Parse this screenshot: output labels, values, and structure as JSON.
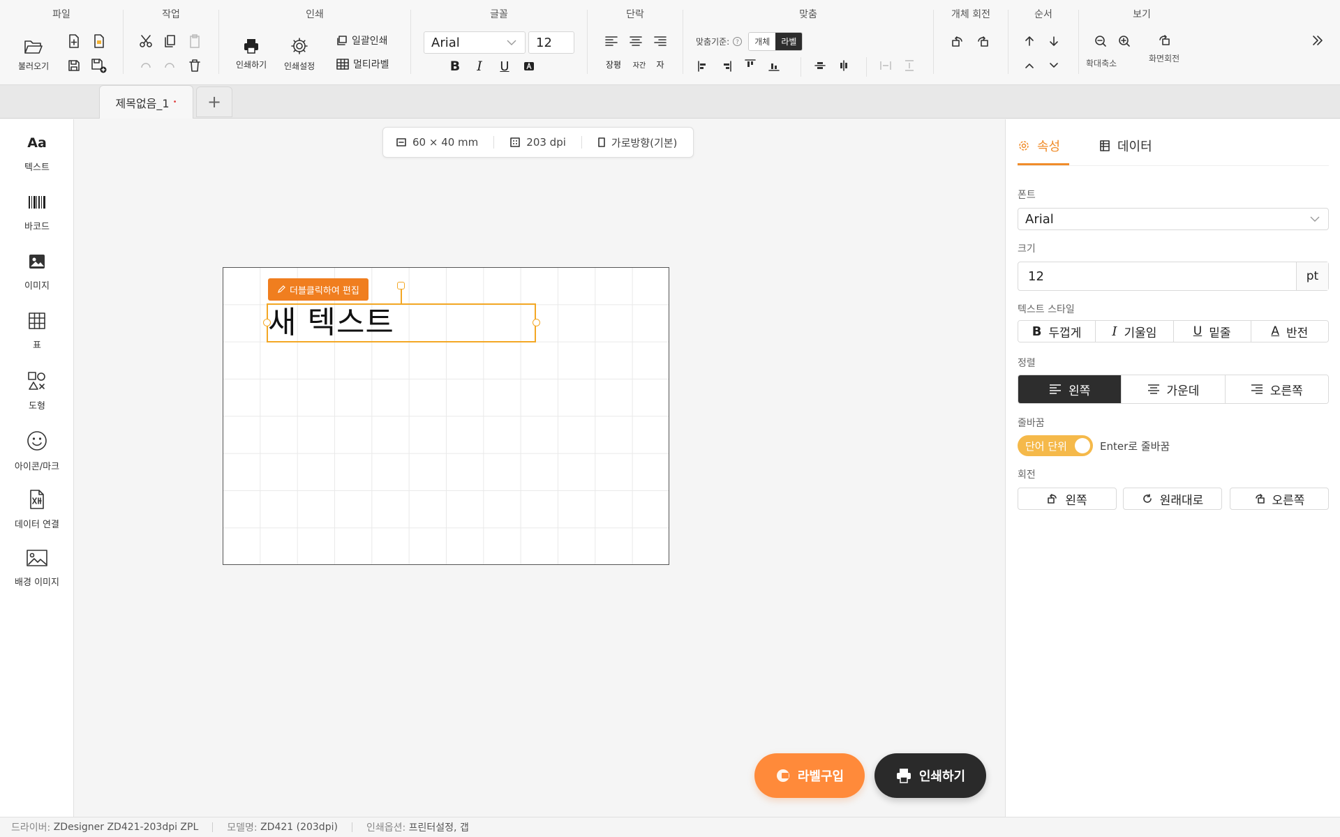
{
  "ribbon": {
    "file": {
      "title": "파일",
      "open_label": "불러오기"
    },
    "edit": {
      "title": "작업"
    },
    "print": {
      "title": "인쇄",
      "print_label": "인쇄하기",
      "settings_label": "인쇄설정",
      "batch_label": "일괄인쇄",
      "multi_label": "멀티라벨"
    },
    "font": {
      "title": "글꼴",
      "family": "Arial",
      "size": "12",
      "bold": "B",
      "italic": "I",
      "underline": "U"
    },
    "paragraph": {
      "title": "단락",
      "jangpyeong": "장평",
      "jagan": "자간",
      "ja": "자"
    },
    "align": {
      "title": "맞춤",
      "basis_label": "맞춤기준:",
      "basis_object": "개체",
      "basis_label_opt": "라벨"
    },
    "rotate": {
      "title": "개체 회전"
    },
    "order": {
      "title": "순서"
    },
    "view": {
      "title": "보기",
      "zoom_label": "확대축소",
      "screen_rotate_label": "화면회전"
    }
  },
  "tabs": {
    "doc_name": "제목없음_1",
    "dirty_mark": "•",
    "add": "+"
  },
  "tools": [
    {
      "icon": "text-icon",
      "label": "텍스트",
      "glyph": "Aa"
    },
    {
      "icon": "barcode-icon",
      "label": "바코드"
    },
    {
      "icon": "image-icon",
      "label": "이미지"
    },
    {
      "icon": "table-icon",
      "label": "표"
    },
    {
      "icon": "shape-icon",
      "label": "도형"
    },
    {
      "icon": "emoji-icon",
      "label": "아이콘/마크"
    },
    {
      "icon": "data-link-icon",
      "label": "데이터 연결"
    },
    {
      "icon": "background-image-icon",
      "label": "배경 이미지"
    }
  ],
  "canvas": {
    "info": {
      "size": "60 × 40 mm",
      "dpi": "203 dpi",
      "orientation": "가로방향(기본)"
    },
    "edit_hint": "더블클릭하여 편집",
    "text_content": "새 텍스트",
    "buy_button": "라벨구입",
    "print_button": "인쇄하기"
  },
  "panel": {
    "tab_props": "속성",
    "tab_data": "데이터",
    "font_label": "폰트",
    "font_value": "Arial",
    "size_label": "크기",
    "size_value": "12",
    "size_unit": "pt",
    "style_label": "텍스트 스타일",
    "style_bold": "두껍게",
    "style_italic": "기울임",
    "style_underline": "밑줄",
    "style_invert": "반전",
    "style_bold_glyph": "B",
    "style_italic_glyph": "I",
    "style_underline_glyph": "U",
    "style_invert_glyph": "A",
    "align_label": "정렬",
    "align_left": "왼쪽",
    "align_center": "가운데",
    "align_right": "오른쪽",
    "wrap_label": "줄바꿈",
    "wrap_toggle": "단어 단위",
    "wrap_toggle_on": true,
    "wrap_enter": "Enter로 줄바꿈",
    "rotate_label": "회전",
    "rotate_left": "왼쪽",
    "rotate_reset": "원래대로",
    "rotate_right": "오른쪽"
  },
  "status": {
    "driver_key": "드라이버:",
    "driver_val": "ZDesigner ZD421-203dpi ZPL",
    "model_key": "모델명:",
    "model_val": "ZD421 (203dpi)",
    "options_key": "인쇄옵션:",
    "options_val": "프린터설정, 갭"
  },
  "colors": {
    "accent": "#f08c2a",
    "selection": "#f3a724",
    "dark": "#2d2d2d",
    "buy": "#ff8a3a"
  }
}
